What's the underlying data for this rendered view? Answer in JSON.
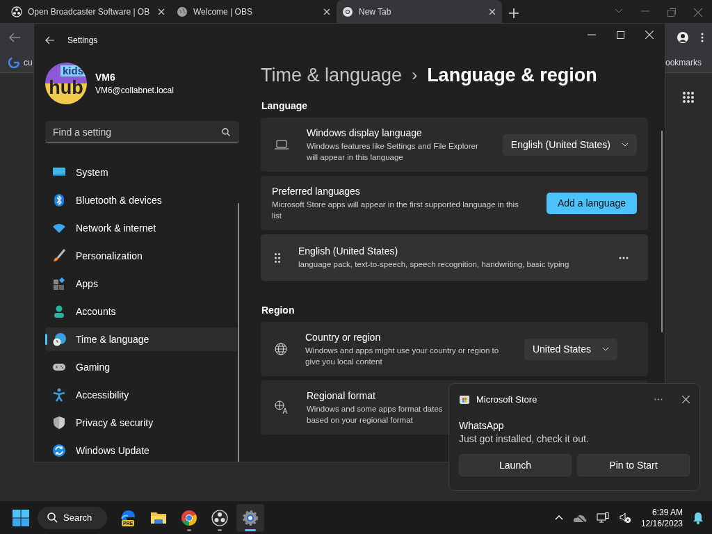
{
  "browser": {
    "tabs": [
      {
        "title": "Open Broadcaster Software | OB",
        "selected": false
      },
      {
        "title": "Welcome | OBS",
        "selected": false
      },
      {
        "title": "New Tab",
        "selected": true
      }
    ],
    "bookmarks_bar": {
      "left_item": "cu",
      "right_item": "ookmarks"
    }
  },
  "settings": {
    "title": "Settings",
    "account": {
      "avatar_top": "kids",
      "avatar_bottom": "hub",
      "name": "VM6",
      "email": "VM6@collabnet.local"
    },
    "search": {
      "placeholder": "Find a setting"
    },
    "nav": [
      {
        "label": "System",
        "selected": false
      },
      {
        "label": "Bluetooth & devices",
        "selected": false
      },
      {
        "label": "Network & internet",
        "selected": false
      },
      {
        "label": "Personalization",
        "selected": false
      },
      {
        "label": "Apps",
        "selected": false
      },
      {
        "label": "Accounts",
        "selected": false
      },
      {
        "label": "Time & language",
        "selected": true
      },
      {
        "label": "Gaming",
        "selected": false
      },
      {
        "label": "Accessibility",
        "selected": false
      },
      {
        "label": "Privacy & security",
        "selected": false
      },
      {
        "label": "Windows Update",
        "selected": false
      }
    ],
    "breadcrumb": {
      "parent": "Time & language",
      "separator": "›",
      "current": "Language & region"
    },
    "sections": [
      {
        "title": "Language",
        "cards": [
          {
            "kind": "display",
            "title": "Windows display language",
            "description": "Windows features like Settings and File Explorer will appear in this language",
            "value": "English (United States)"
          },
          {
            "kind": "preferred",
            "title": "Preferred languages",
            "description": "Microsoft Store apps will appear in the first supported language in this list",
            "action": "Add a language"
          },
          {
            "kind": "language",
            "title": "English (United States)",
            "description": "language pack, text-to-speech, speech recognition, handwriting, basic typing"
          }
        ]
      },
      {
        "title": "Region",
        "cards": [
          {
            "kind": "country",
            "title": "Country or region",
            "description": "Windows and apps might use your country or region to give you local content",
            "value": "United States"
          },
          {
            "kind": "format",
            "title": "Regional format",
            "description": "Windows and some apps format dates based on your regional format"
          }
        ]
      }
    ]
  },
  "notification": {
    "app": "Microsoft Store",
    "title": "WhatsApp",
    "body": "Just got installed, check it out.",
    "buttons": [
      "Launch",
      "Pin to Start"
    ]
  },
  "taskbar": {
    "search_label": "Search",
    "badge": "PRE",
    "apps": [
      {
        "running": false,
        "selected": false
      },
      {
        "running": false,
        "selected": false
      },
      {
        "running": true,
        "selected": false
      },
      {
        "running": true,
        "selected": false
      },
      {
        "running": true,
        "selected": true
      }
    ],
    "time": "6:39 AM",
    "date": "12/16/2023"
  }
}
